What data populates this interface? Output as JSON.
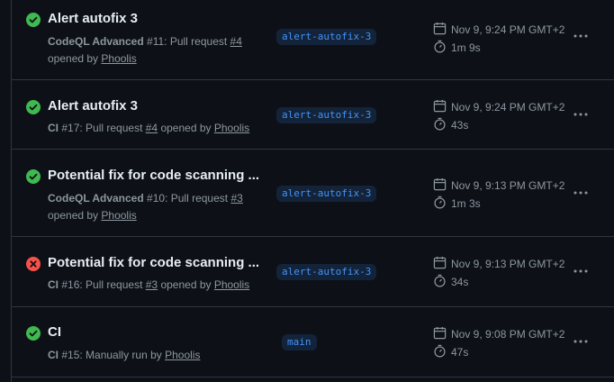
{
  "colors": {
    "success": "#3fb950",
    "failure": "#f85149",
    "branch_text": "#4493f8",
    "muted": "#8d96a0"
  },
  "runs": [
    {
      "status": "success",
      "title": "Alert autofix 3",
      "workflow": "CodeQL Advanced",
      "run_no": "#11",
      "trigger_pre": ": Pull request ",
      "pr": "#4",
      "trigger_post": " opened by ",
      "actor": "Phoolis",
      "branch": "alert-autofix-3",
      "date": "Nov 9, 9:24 PM GMT+2",
      "duration": "1m 9s"
    },
    {
      "status": "success",
      "title": "Alert autofix 3",
      "workflow": "CI",
      "run_no": "#17",
      "trigger_pre": ": Pull request ",
      "pr": "#4",
      "trigger_post": " opened by ",
      "actor": "Phoolis",
      "branch": "alert-autofix-3",
      "date": "Nov 9, 9:24 PM GMT+2",
      "duration": "43s"
    },
    {
      "status": "success",
      "title": "Potential fix for code scanning ...",
      "workflow": "CodeQL Advanced",
      "run_no": "#10",
      "trigger_pre": ": Pull request ",
      "pr": "#3",
      "trigger_post": " opened by ",
      "actor": "Phoolis",
      "branch": "alert-autofix-3",
      "date": "Nov 9, 9:13 PM GMT+2",
      "duration": "1m 3s"
    },
    {
      "status": "failure",
      "title": "Potential fix for code scanning ...",
      "workflow": "CI",
      "run_no": "#16",
      "trigger_pre": ": Pull request ",
      "pr": "#3",
      "trigger_post": " opened by ",
      "actor": "Phoolis",
      "branch": "alert-autofix-3",
      "date": "Nov 9, 9:13 PM GMT+2",
      "duration": "34s"
    },
    {
      "status": "success",
      "title": "CI",
      "workflow": "CI",
      "run_no": "#15",
      "trigger_pre": ": Manually run by ",
      "actor": "Phoolis",
      "branch": "main",
      "date": "Nov 9, 9:08 PM GMT+2",
      "duration": "47s"
    }
  ]
}
